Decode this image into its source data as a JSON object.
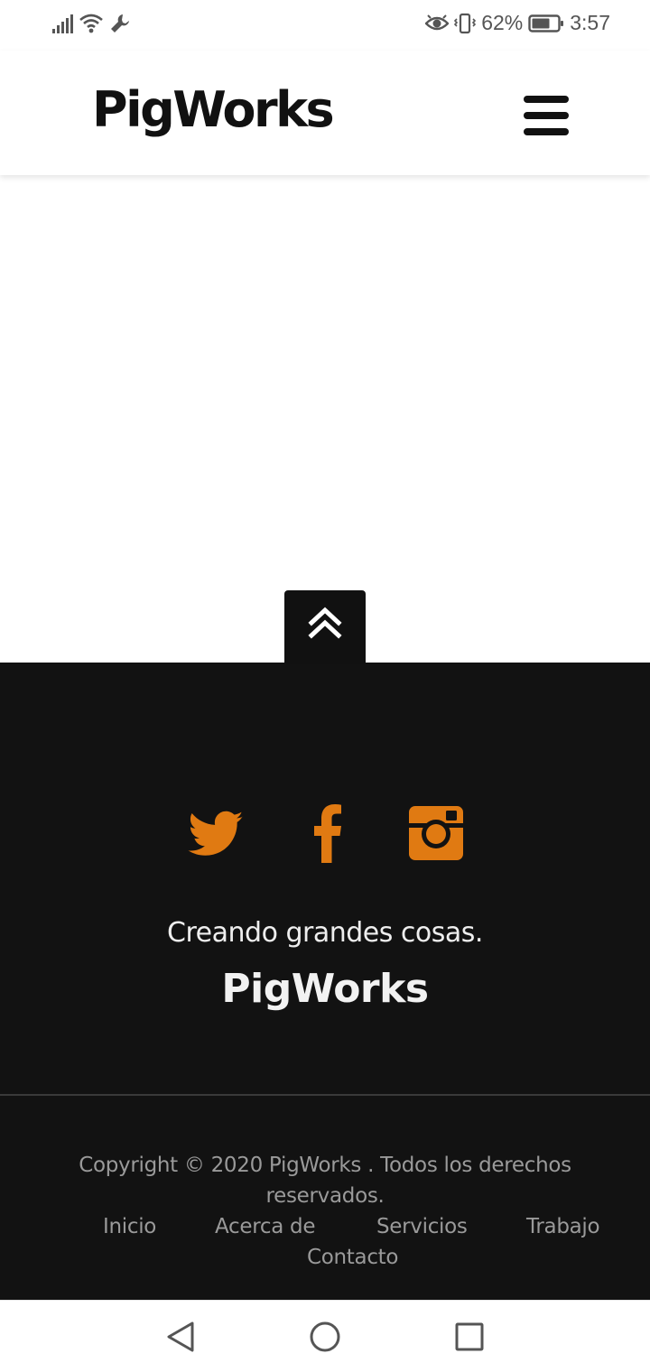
{
  "status_bar": {
    "battery_percent": "62%",
    "time": "3:57",
    "icons": [
      "signal-icon",
      "wifi-icon",
      "wrench-icon",
      "eye-icon",
      "vibrate-icon",
      "battery-icon"
    ]
  },
  "header": {
    "brand": "PigWorks",
    "menu_icon": "hamburger-menu-icon"
  },
  "back_to_top": {
    "icon": "double-chevron-up-icon"
  },
  "footer": {
    "social_links": [
      {
        "name": "twitter",
        "icon": "twitter-icon"
      },
      {
        "name": "facebook",
        "icon": "facebook-icon"
      },
      {
        "name": "instagram",
        "icon": "instagram-icon"
      }
    ],
    "social_color": "#E07A12",
    "tagline": "Creando grandes cosas.",
    "brand": "PigWorks",
    "copyright_line1": "Copyright © 2020 PigWorks . Todos los derechos",
    "copyright_line2": "reservados.",
    "nav": [
      "Inicio",
      "Acerca de",
      "Servicios",
      "Trabajo",
      "Contacto"
    ]
  },
  "system_nav": {
    "icons": [
      "back-icon",
      "home-icon",
      "recents-icon"
    ]
  },
  "colors": {
    "footer_bg": "#121212",
    "accent": "#E07A12",
    "text_dark": "#111111"
  }
}
